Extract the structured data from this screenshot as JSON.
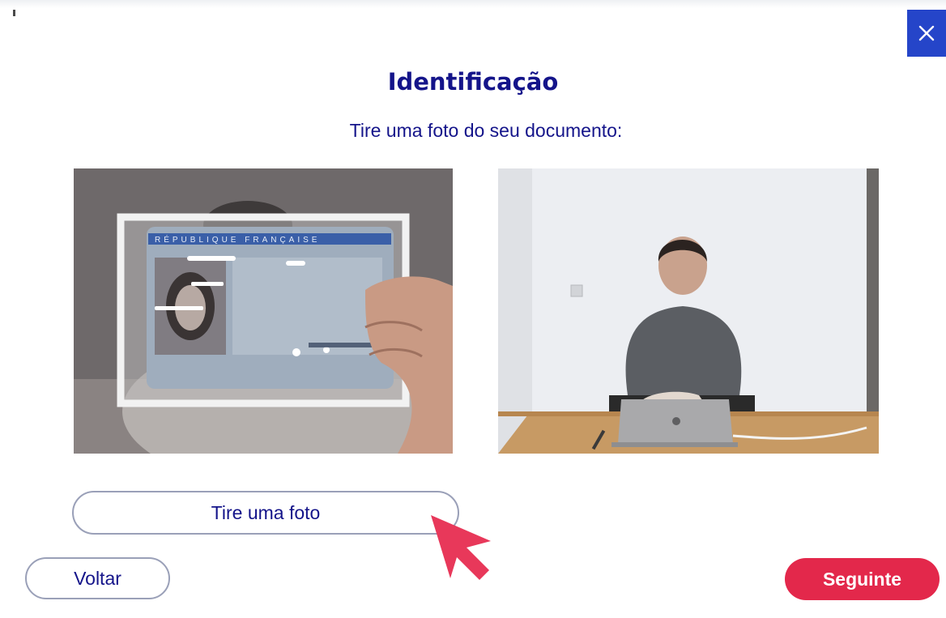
{
  "header": {
    "title": "Identificação",
    "subtitle": "Tire uma foto do seu documento:"
  },
  "close_icon": "close-icon",
  "document_preview": {
    "card_header_text": "RÉPUBLIQUE FRANÇAISE"
  },
  "actions": {
    "take_photo_label": "Tire uma foto",
    "back_label": "Voltar",
    "next_label": "Seguinte"
  },
  "colors": {
    "primary_text": "#14148a",
    "close_button": "#2545c9",
    "next_button": "#e3284b",
    "cursor": "#e8385a"
  }
}
